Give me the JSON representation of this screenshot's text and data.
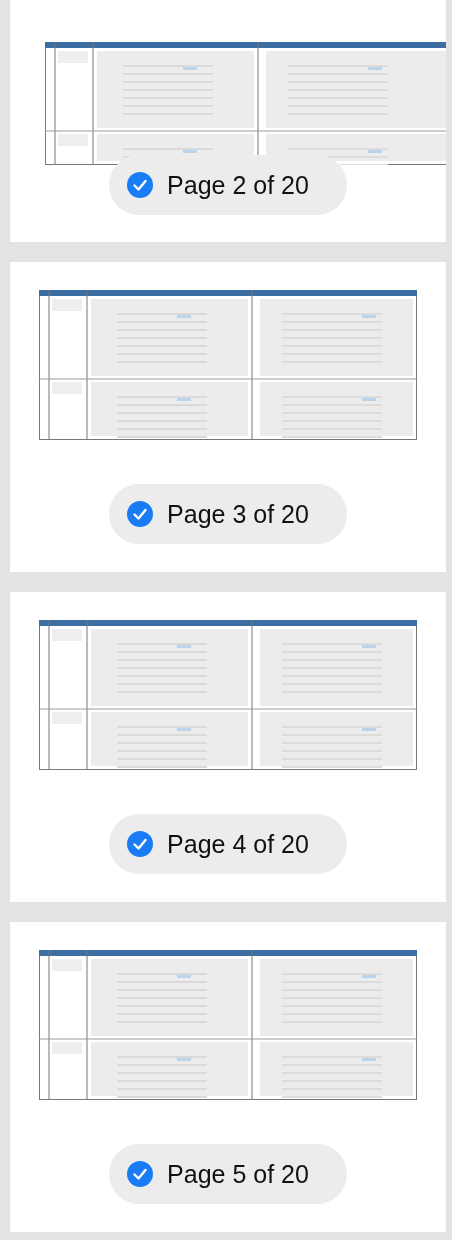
{
  "pages": [
    {
      "label": "Page 2 of 20",
      "selected": true
    },
    {
      "label": "Page 3 of 20",
      "selected": true
    },
    {
      "label": "Page 4 of 20",
      "selected": true
    },
    {
      "label": "Page 5 of 20",
      "selected": true
    }
  ]
}
